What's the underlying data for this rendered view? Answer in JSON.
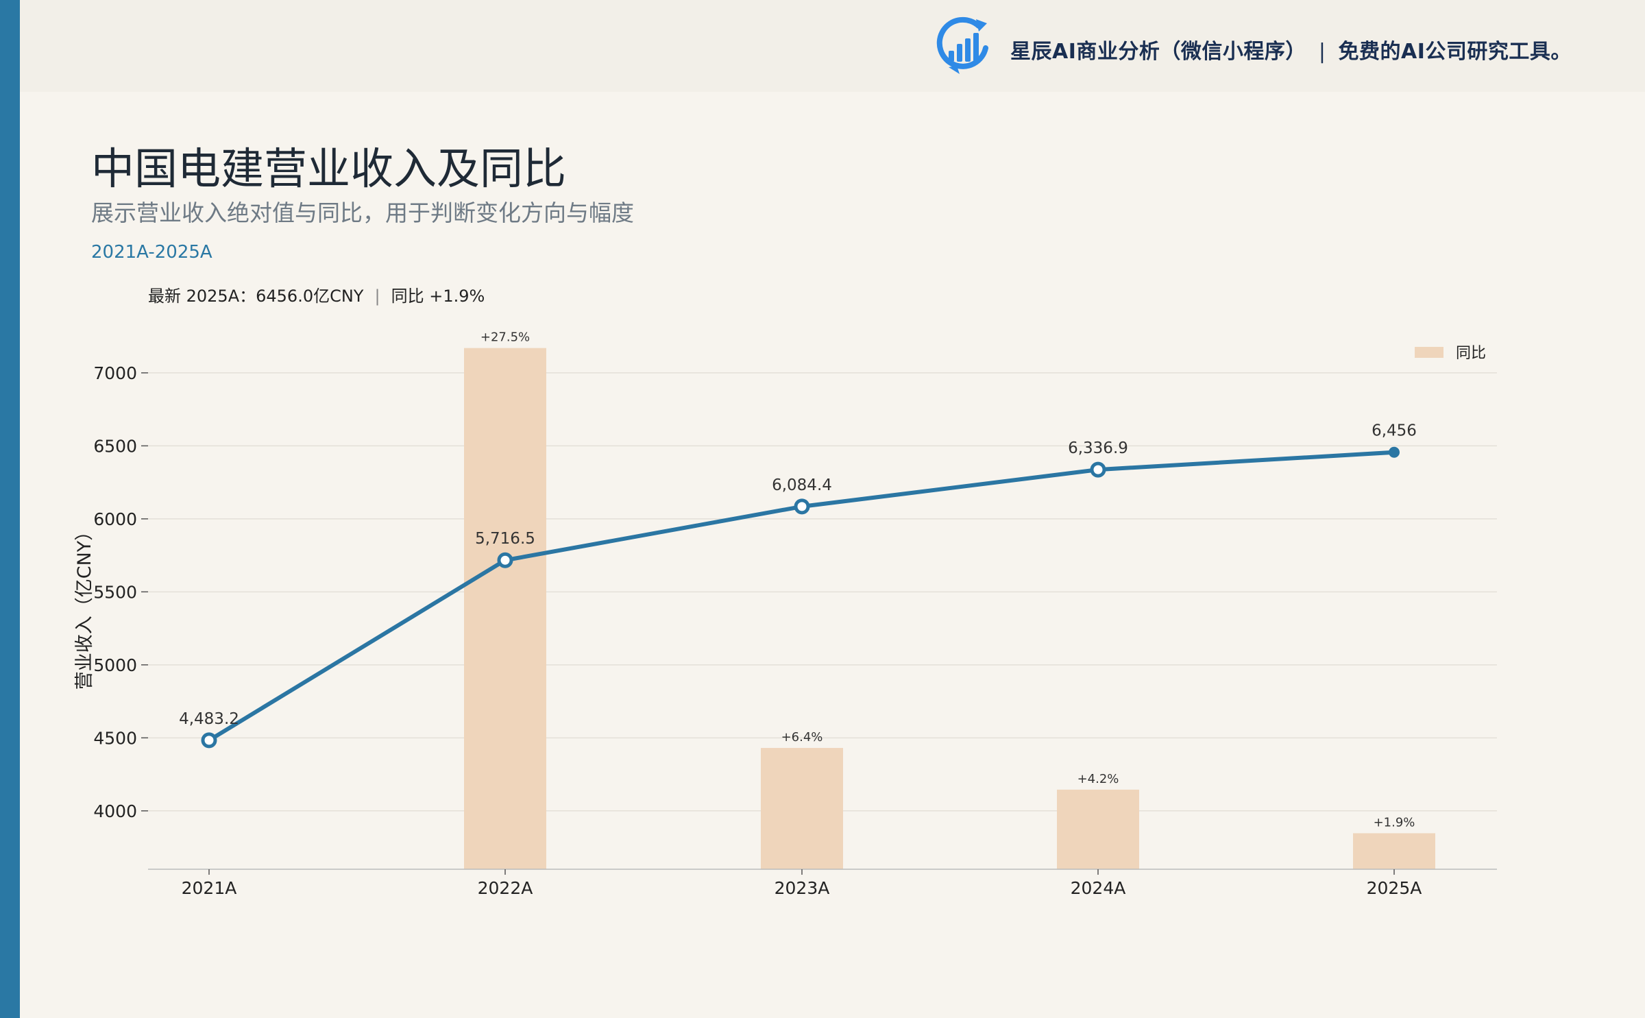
{
  "brand": {
    "name": "星辰AI商业分析（微信小程序）",
    "separator": "|",
    "tagline": "免费的AI公司研究工具。"
  },
  "header": {
    "title": "中国电建营业收入及同比",
    "subtitle": "展示营业收入绝对值与同比，用于判断变化方向与幅度",
    "period": "2021A-2025A",
    "latest_label": "最新 2025A：6456.0亿CNY",
    "latest_separator": "|",
    "latest_yoy": "同比 +1.9%"
  },
  "colors": {
    "accent": "#2a78a4",
    "line": "#2b76a3",
    "bar": "#efd5bb",
    "background": "#f7f4ee"
  },
  "chart_data": {
    "type": "bar+line",
    "categories": [
      "2021A",
      "2022A",
      "2023A",
      "2024A",
      "2025A"
    ],
    "ylabel": "营业收入（亿CNY）",
    "ylim": [
      3600,
      7300
    ],
    "yticks": [
      4000,
      4500,
      5000,
      5500,
      6000,
      6500,
      7000
    ],
    "grid": true,
    "legend_position": "top-right",
    "line_series": {
      "values": [
        4483.2,
        5716.5,
        6084.4,
        6336.9,
        6456
      ],
      "labels": [
        "4,483.2",
        "5,716.5",
        "6,084.4",
        "6,336.9",
        "6,456"
      ]
    },
    "bar_series": {
      "name": "同比",
      "values_pct": [
        null,
        27.5,
        6.4,
        4.2,
        1.9
      ],
      "labels": [
        "",
        "+27.5%",
        "+6.4%",
        "+4.2%",
        "+1.9%"
      ]
    }
  }
}
